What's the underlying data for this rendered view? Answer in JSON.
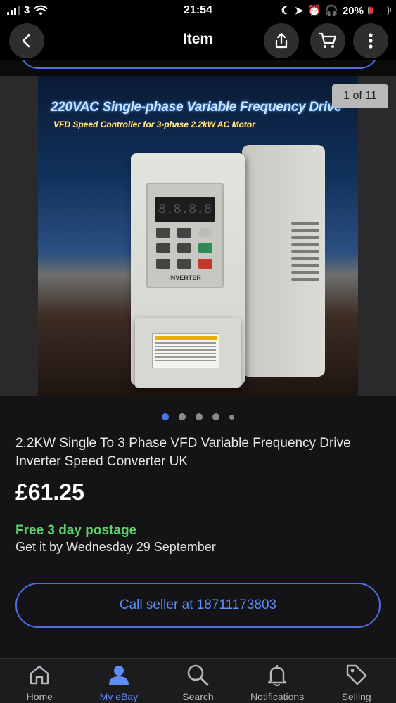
{
  "status_bar": {
    "carrier": "3",
    "time": "21:54",
    "battery": "20%",
    "battery_level": 0.2
  },
  "nav": {
    "title": "Item",
    "icons": [
      "back-icon",
      "share-icon",
      "cart-icon",
      "more-icon"
    ]
  },
  "gallery": {
    "counter": "1 of 11",
    "promo_title": "220VAC Single-phase Variable Frequency Drive",
    "promo_subtitle": "VFD Speed Controller for 3-phase 2.2kW AC Motor",
    "device_label": "INVERTER",
    "dots_active_index": 0,
    "dots_count": 5
  },
  "item": {
    "title": "2.2KW Single To 3 Phase VFD Variable Frequency Drive Inverter Speed Converter UK",
    "price": "£61.25",
    "postage": "Free 3 day postage",
    "delivery": "Get it by Wednesday 29 September",
    "call_button": "Call seller at 18711173803"
  },
  "tabs": [
    {
      "label": "Home",
      "icon": "home-icon",
      "active": false
    },
    {
      "label": "My eBay",
      "icon": "user-icon",
      "active": true
    },
    {
      "label": "Search",
      "icon": "search-icon",
      "active": false
    },
    {
      "label": "Notifications",
      "icon": "bell-icon",
      "active": false
    },
    {
      "label": "Selling",
      "icon": "tag-icon",
      "active": false
    }
  ],
  "colors": {
    "accent": "#5f8cf5",
    "postage_green": "#5fcf6a",
    "background": "#141416"
  }
}
